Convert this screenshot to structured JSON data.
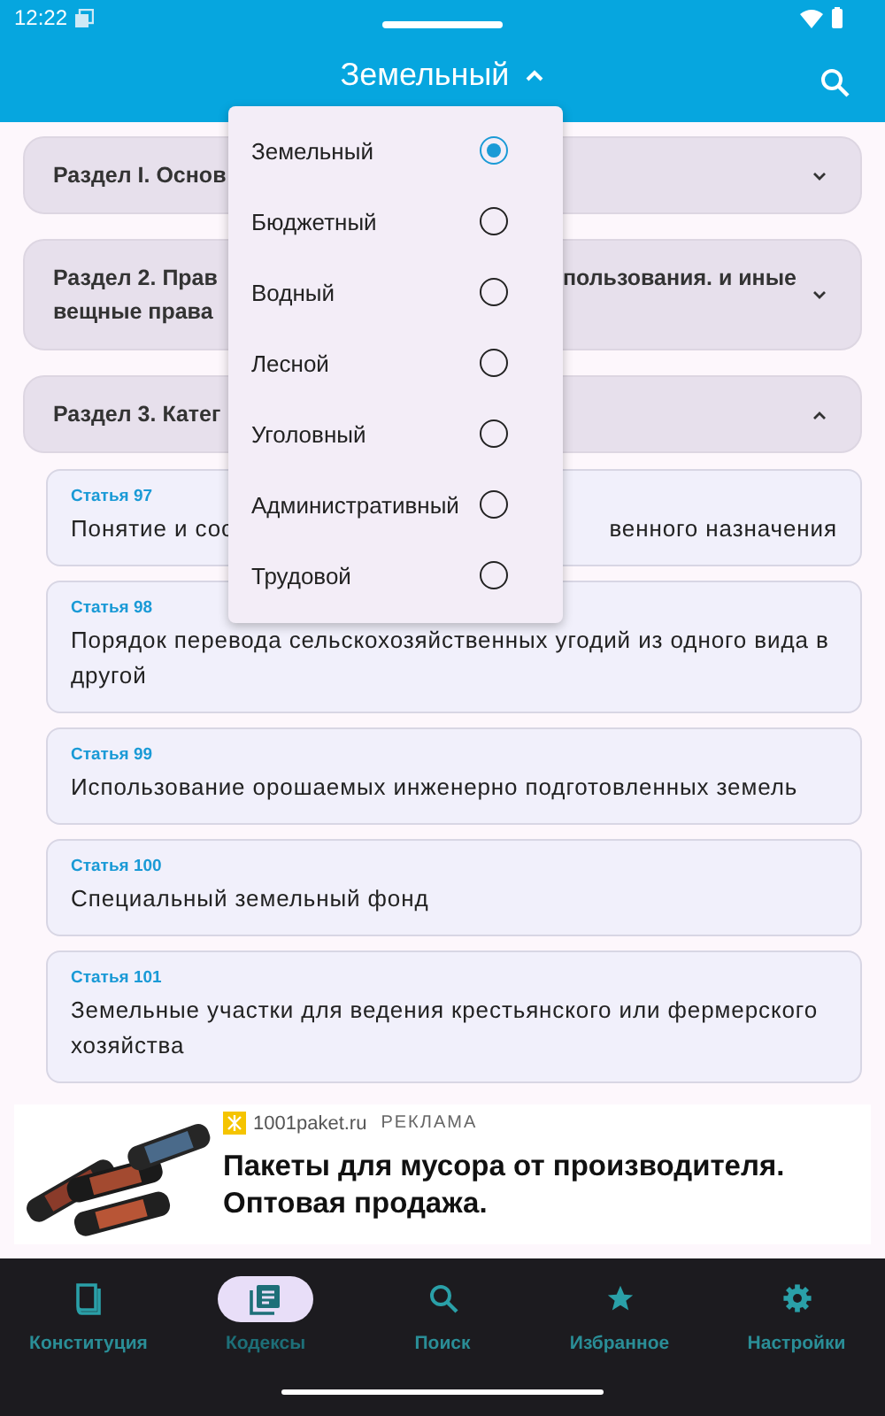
{
  "status_bar": {
    "time": "12:22"
  },
  "app_bar": {
    "title": "Земельный",
    "expanded": true
  },
  "menu": {
    "items": [
      {
        "label": "Земельный",
        "selected": true
      },
      {
        "label": "Бюджетный",
        "selected": false
      },
      {
        "label": "Водный",
        "selected": false
      },
      {
        "label": "Лесной",
        "selected": false
      },
      {
        "label": "Уголовный",
        "selected": false
      },
      {
        "label": "Административный",
        "selected": false
      },
      {
        "label": "Трудовой",
        "selected": false
      }
    ]
  },
  "sections": [
    {
      "title_left": [
        "Раздел I. Основ"
      ],
      "expanded": false
    },
    {
      "title_left": [
        "Раздел 2. Прав",
        "вещные права"
      ],
      "title_right": "пользования. и иные",
      "expanded": false
    },
    {
      "title_left": [
        "Раздел 3. Катег"
      ],
      "expanded": true
    }
  ],
  "articles": [
    {
      "number": "Статья 97",
      "title_left": "Понятие и сос",
      "title_right": "венного назначения"
    },
    {
      "number": "Статья 98",
      "title_left": "Порядок перевода сельскохозяйственных угодий из одного вида в другой"
    },
    {
      "number": "Статья 99",
      "title_left": "Использование орошаемых инженерно подготовленных земель"
    },
    {
      "number": "Статья 100",
      "title_left": "Специальный земельный фонд"
    },
    {
      "number": "Статья 101",
      "title_left": "Земельные участки для ведения крестьянского или фермерского хозяйства"
    }
  ],
  "ad": {
    "kind": "picture",
    "domain": "1001paket.ru",
    "label": "РЕКЛАМА",
    "text": "Пакеты для мусора от производителя. Оптовая продажа."
  },
  "nav": [
    {
      "label": "Конституция",
      "selected": false
    },
    {
      "label": "Кодексы",
      "selected": true
    },
    {
      "label": "Поиск",
      "selected": false
    },
    {
      "label": "Избранное",
      "selected": false
    },
    {
      "label": "Настройки",
      "selected": false
    }
  ]
}
